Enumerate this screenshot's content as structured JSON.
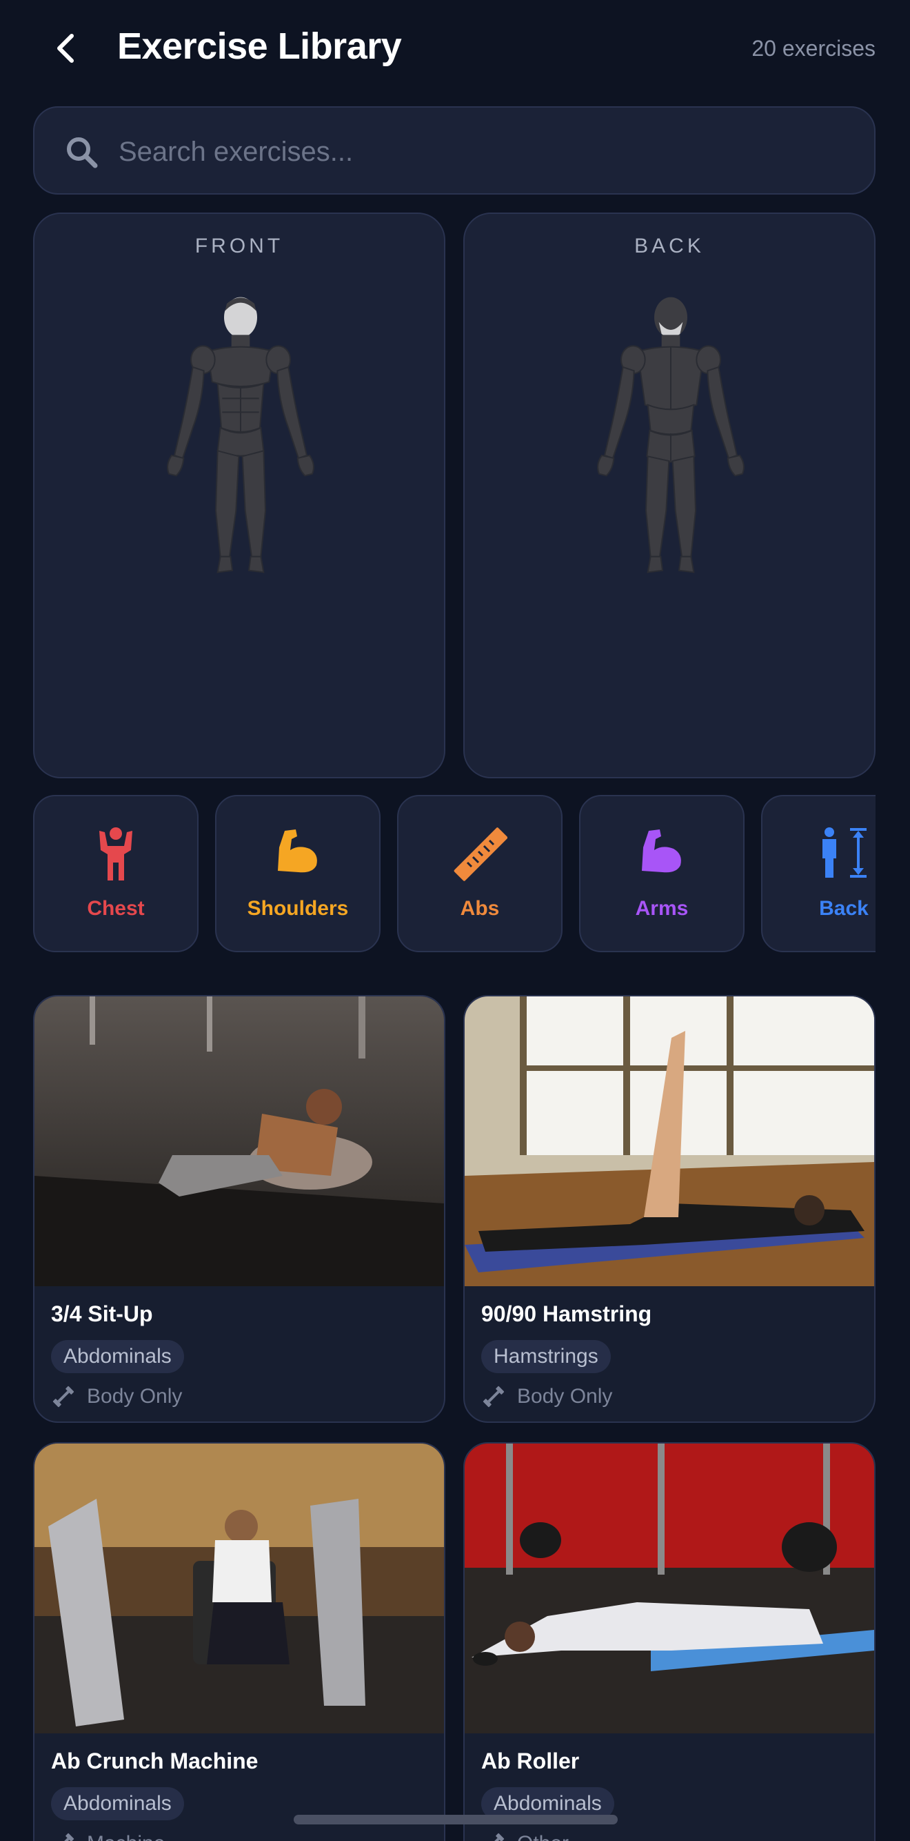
{
  "header": {
    "title": "Exercise Library",
    "count": "20 exercises"
  },
  "search": {
    "placeholder": "Search exercises..."
  },
  "body_map": {
    "front_label": "FRONT",
    "back_label": "BACK"
  },
  "categories": [
    {
      "label": "Chest",
      "icon": "person-arms-up-icon",
      "color": "#e5484d"
    },
    {
      "label": "Shoulders",
      "icon": "flexed-arm-icon",
      "color": "#f5a623"
    },
    {
      "label": "Abs",
      "icon": "ruler-icon",
      "color": "#f08a3c"
    },
    {
      "label": "Arms",
      "icon": "flexed-arm-icon",
      "color": "#a855f7"
    },
    {
      "label": "Back",
      "icon": "person-height-icon",
      "color": "#3b82f6"
    }
  ],
  "exercises": [
    {
      "name": "3/4 Sit-Up",
      "muscle": "Abdominals",
      "equipment": "Body Only"
    },
    {
      "name": "90/90 Hamstring",
      "muscle": "Hamstrings",
      "equipment": "Body Only"
    },
    {
      "name": "Ab Crunch Machine",
      "muscle": "Abdominals",
      "equipment": "Machine"
    },
    {
      "name": "Ab Roller",
      "muscle": "Abdominals",
      "equipment": "Other"
    }
  ]
}
